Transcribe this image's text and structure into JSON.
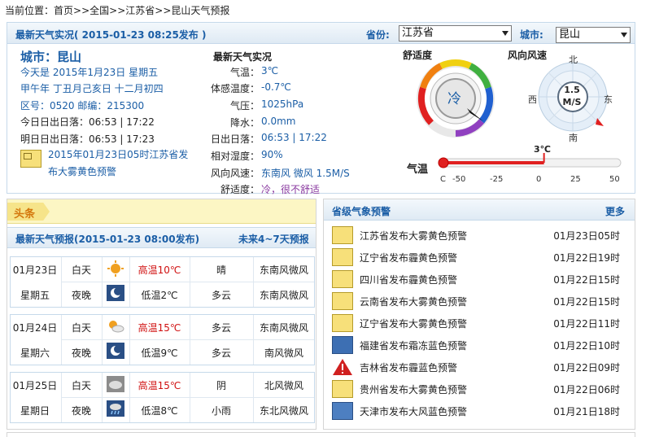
{
  "breadcrumb": {
    "prefix": "当前位置：",
    "items": [
      "首页",
      ">>全国",
      ">>江苏省",
      ">>昆山天气预报"
    ]
  },
  "header": {
    "title": "最新天气实况",
    "time": "( 2015-01-23  08:25发布 )",
    "province_label": "省份:",
    "province_value": "江苏省",
    "city_label": "城市:",
    "city_value": "昆山"
  },
  "info": {
    "city": "城市：昆山",
    "today": "今天是  2015年1月23日  星期五",
    "lunar": "甲午年  丁丑月己亥日  十二月初四",
    "area": "区号：0520   邮编：215300",
    "today_sun": "今日日出日落：06:53  | 17:22",
    "tomorrow_sun": "明日日出日落：06:53  | 17:23",
    "warning1": "2015年01月23日05时江苏省发",
    "warning2": "布大雾黄色预警"
  },
  "live": {
    "title": "最新天气实况",
    "rows": [
      {
        "label": "气温：",
        "value": "3℃"
      },
      {
        "label": "体感温度：",
        "value": "-0.7℃"
      },
      {
        "label": "气压：",
        "value": "1025hPa"
      },
      {
        "label": "降水：",
        "value": "0.0mm"
      },
      {
        "label": "日出日落：",
        "value": "06:53  | 17:22"
      },
      {
        "label": "相对湿度：",
        "value": "90%"
      },
      {
        "label": "风向风速：",
        "value": "东南风  微风  1.5M/S"
      },
      {
        "label": "舒适度：",
        "value": "冷，很不舒适"
      }
    ]
  },
  "comfort": {
    "title": "舒适度",
    "value": "冷"
  },
  "wind": {
    "title": "风向风速",
    "speed": "1.5",
    "unit": "M/S",
    "north": "北",
    "south": "南",
    "east": "东",
    "west": "西"
  },
  "temp_bar": {
    "label": "气温",
    "current": "3℃",
    "current_value": 3,
    "ticks": [
      "C",
      "-50",
      "-25",
      "0",
      "25",
      "50"
    ],
    "min": -50,
    "max": 50
  },
  "toutiao": {
    "label": "头条"
  },
  "forecast": {
    "title": "最新天气预报(2015-01-23  08:00发布)",
    "link": "未来4~7天预报",
    "days": [
      {
        "date": "01月23日",
        "week": "星期五",
        "day": {
          "period": "白天",
          "temp": "高温10℃",
          "weather": "晴",
          "wind": "东南风微风",
          "icon": "sunny-icon"
        },
        "night": {
          "period": "夜晚",
          "temp": "低温2℃",
          "weather": "多云",
          "wind": "东南风微风",
          "icon": "moon-icon"
        }
      },
      {
        "date": "01月24日",
        "week": "星期六",
        "day": {
          "period": "白天",
          "temp": "高温15℃",
          "weather": "多云",
          "wind": "东南风微风",
          "icon": "partly-cloudy-icon"
        },
        "night": {
          "period": "夜晚",
          "temp": "低温9℃",
          "weather": "多云",
          "wind": "南风微风",
          "icon": "moon-icon"
        }
      },
      {
        "date": "01月25日",
        "week": "星期日",
        "day": {
          "period": "白天",
          "temp": "高温15℃",
          "weather": "阴",
          "wind": "北风微风",
          "icon": "overcast-icon"
        },
        "night": {
          "period": "夜晚",
          "temp": "低温8℃",
          "weather": "小雨",
          "wind": "东北风微风",
          "icon": "light-rain-icon"
        }
      }
    ]
  },
  "alerts": {
    "title": "省级气象预警",
    "more": "更多",
    "items": [
      {
        "text": "江苏省发布大雾黄色预警",
        "time": "01月23日05时",
        "icon": "fog-warning-icon"
      },
      {
        "text": "辽宁省发布霾黄色预警",
        "time": "01月22日19时",
        "icon": "haze-warning-icon"
      },
      {
        "text": "四川省发布霾黄色预警",
        "time": "01月22日15时",
        "icon": "haze-warning-icon"
      },
      {
        "text": "云南省发布大雾黄色预警",
        "time": "01月22日15时",
        "icon": "fog-warning-icon"
      },
      {
        "text": "辽宁省发布大雾黄色预警",
        "time": "01月22日11时",
        "icon": "fog-warning-icon"
      },
      {
        "text": "福建省发布霜冻蓝色预警",
        "time": "01月22日10时",
        "icon": "frost-warning-icon"
      },
      {
        "text": "吉林省发布霾蓝色预警",
        "time": "01月22日09时",
        "icon": "warning-triangle-icon"
      },
      {
        "text": "贵州省发布大雾黄色预警",
        "time": "01月22日06时",
        "icon": "fog-warning-icon"
      },
      {
        "text": "天津市发布大风蓝色预警",
        "time": "01月21日18时",
        "icon": "wind-warning-icon"
      }
    ]
  },
  "colors": {
    "accent": "#1b5ea6",
    "high_temp": "#d01010",
    "comfort_text": "#8a3aa0"
  }
}
